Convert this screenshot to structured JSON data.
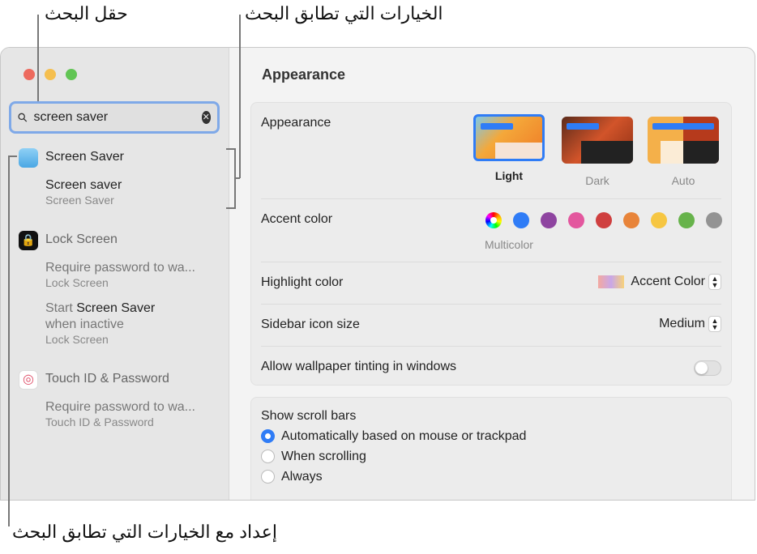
{
  "callouts": {
    "search_field": "حقل البحث",
    "matching_options": "الخيارات التي تطابق البحث",
    "setting_with_options": "إعداد مع الخيارات التي تطابق البحث"
  },
  "search": {
    "value": "screen saver",
    "icon": "magnifier-icon",
    "clear_icon": "x-circle-icon"
  },
  "results": [
    {
      "title": "Screen Saver",
      "icon": "screen-saver-icon",
      "items": [
        {
          "text": "Screen saver",
          "sub": "Screen Saver"
        }
      ]
    },
    {
      "title": "Lock Screen",
      "icon": "lock-icon",
      "items": [
        {
          "text": "Require password to wa...",
          "sub": "Lock Screen"
        },
        {
          "pre": "Start ",
          "match": "Screen Saver",
          "post": "when inactive",
          "sub": "Lock Screen"
        }
      ]
    },
    {
      "title": "Touch ID & Password",
      "icon": "fingerprint-icon",
      "items": [
        {
          "text": "Require password to wa...",
          "sub": "Touch ID & Password"
        }
      ]
    }
  ],
  "main": {
    "title": "Appearance",
    "appearance": {
      "label": "Appearance",
      "options": [
        "Light",
        "Dark",
        "Auto"
      ],
      "selected": "Light"
    },
    "accent": {
      "label": "Accent color",
      "selected_label": "Multicolor",
      "colors": [
        "#2f7cf6",
        "#8e44a0",
        "#e3579e",
        "#cf3f3f",
        "#e8843a",
        "#f6c642",
        "#67b34b",
        "#939393"
      ]
    },
    "highlight": {
      "label": "Highlight color",
      "value": "Accent Color"
    },
    "sidebar_icon": {
      "label": "Sidebar icon size",
      "value": "Medium"
    },
    "tinting": {
      "label": "Allow wallpaper tinting in windows",
      "on": false
    },
    "scroll": {
      "label": "Show scroll bars",
      "options": [
        "Automatically based on mouse or trackpad",
        "When scrolling",
        "Always"
      ],
      "selected": 0
    }
  }
}
